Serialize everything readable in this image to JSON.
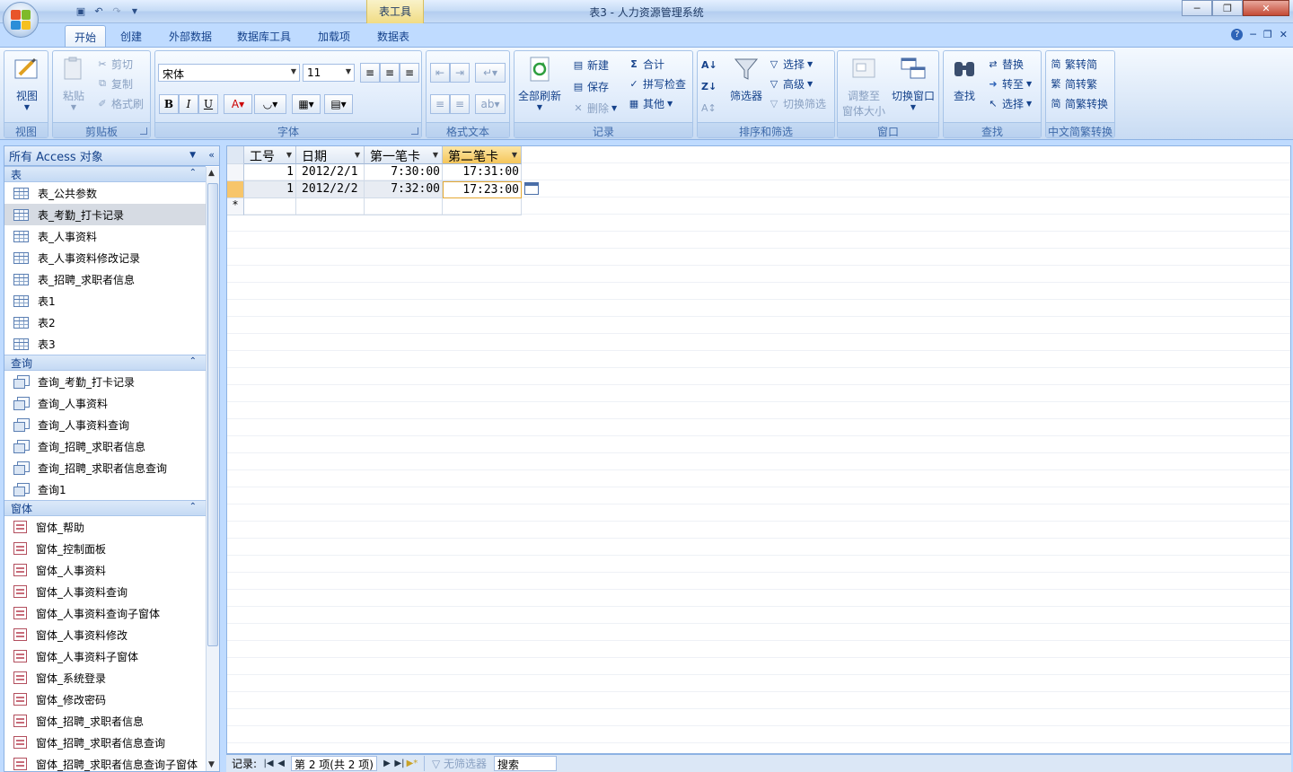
{
  "window": {
    "title": "表3 - 人力资源管理系统",
    "context_tab": "表工具"
  },
  "tabs": [
    "开始",
    "创建",
    "外部数据",
    "数据库工具",
    "加载项",
    "数据表"
  ],
  "ribbon": {
    "view": {
      "label": "视图",
      "group": "视图"
    },
    "clipboard": {
      "paste": "粘贴",
      "cut": "剪切",
      "copy": "复制",
      "format_painter": "格式刷",
      "group": "剪贴板"
    },
    "font": {
      "name": "宋体",
      "size": "11",
      "bold": "B",
      "italic": "I",
      "underline": "U",
      "group": "字体"
    },
    "rich_text": {
      "group": "格式文本"
    },
    "records": {
      "refresh_all": "全部刷新",
      "new": "新建",
      "save": "保存",
      "delete": "删除",
      "totals": "合计",
      "spelling": "拼写检查",
      "more": "其他",
      "group": "记录"
    },
    "sort_filter": {
      "filter": "筛选器",
      "selection": "选择",
      "advanced": "高级",
      "toggle_filter": "切换筛选",
      "group": "排序和筛选"
    },
    "window": {
      "fit": "调整至",
      "fit2": "窗体大小",
      "switch": "切换窗口",
      "group": "窗口"
    },
    "find": {
      "find": "查找",
      "replace": "替换",
      "goto": "转至",
      "select": "选择",
      "group": "查找"
    },
    "chinese": {
      "t2s": "繁转简",
      "s2t": "简转繁",
      "convert": "简繁转换",
      "group": "中文简繁转换"
    }
  },
  "nav": {
    "header": "所有 Access 对象",
    "sections": [
      {
        "title": "表",
        "kind": "table",
        "items": [
          "表_公共参数",
          "表_考勤_打卡记录",
          "表_人事资料",
          "表_人事资料修改记录",
          "表_招聘_求职者信息",
          "表1",
          "表2",
          "表3"
        ],
        "selected": 1
      },
      {
        "title": "查询",
        "kind": "query",
        "items": [
          "查询_考勤_打卡记录",
          "查询_人事资料",
          "查询_人事资料查询",
          "查询_招聘_求职者信息",
          "查询_招聘_求职者信息查询",
          "查询1"
        ],
        "selected": -1
      },
      {
        "title": "窗体",
        "kind": "form",
        "items": [
          "窗体_帮助",
          "窗体_控制面板",
          "窗体_人事资料",
          "窗体_人事资料查询",
          "窗体_人事资料查询子窗体",
          "窗体_人事资料修改",
          "窗体_人事资料子窗体",
          "窗体_系统登录",
          "窗体_修改密码",
          "窗体_招聘_求职者信息",
          "窗体_招聘_求职者信息查询",
          "窗体_招聘_求职者信息查询子窗体"
        ],
        "selected": -1
      }
    ]
  },
  "datasheet": {
    "columns": [
      "工号",
      "日期",
      "第一笔卡",
      "第二笔卡"
    ],
    "active_column": 3,
    "rows": [
      [
        "1",
        "2012/2/1",
        "7:30:00",
        "17:31:00"
      ],
      [
        "1",
        "2012/2/2",
        "7:32:00",
        "17:23:00"
      ]
    ],
    "new_row_marker": "*"
  },
  "status": {
    "record_label": "记录:",
    "position": "第 2 项(共 2 项)",
    "filter": "无筛选器",
    "search": "搜索"
  }
}
